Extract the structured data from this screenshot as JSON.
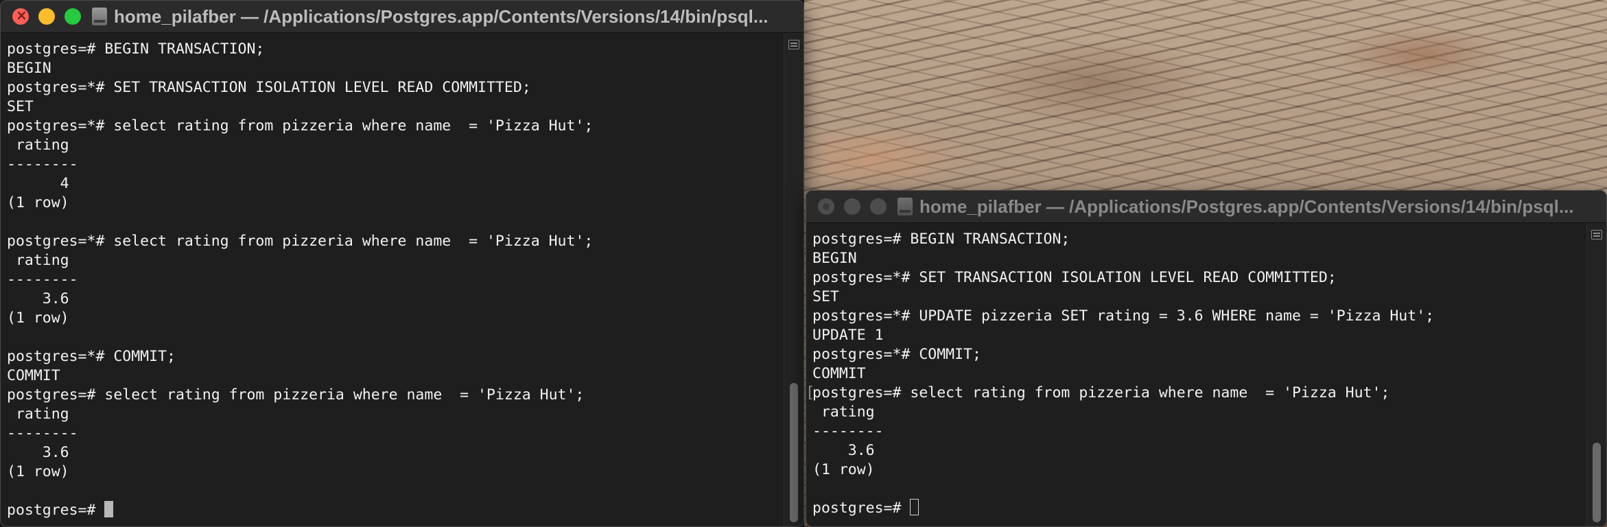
{
  "windows": [
    {
      "title": "home_pilafber — /Applications/Postgres.app/Contents/Versions/14/bin/psql...",
      "lines": [
        "postgres=# BEGIN TRANSACTION;",
        "BEGIN",
        "postgres=*# SET TRANSACTION ISOLATION LEVEL READ COMMITTED;",
        "SET",
        "postgres=*# select rating from pizzeria where name  = 'Pizza Hut';",
        " rating",
        "--------",
        "      4",
        "(1 row)",
        "",
        "postgres=*# select rating from pizzeria where name  = 'Pizza Hut';",
        " rating",
        "--------",
        "    3.6",
        "(1 row)",
        "",
        "postgres=*# COMMIT;",
        "COMMIT",
        "postgres=# select rating from pizzeria where name  = 'Pizza Hut';",
        " rating",
        "--------",
        "    3.6",
        "(1 row)",
        ""
      ],
      "prompt": "postgres=# "
    },
    {
      "title": "home_pilafber — /Applications/Postgres.app/Contents/Versions/14/bin/psql...",
      "lines": [
        "postgres=# BEGIN TRANSACTION;",
        "BEGIN",
        "postgres=*# SET TRANSACTION ISOLATION LEVEL READ COMMITTED;",
        "SET",
        "postgres=*# UPDATE pizzeria SET rating = 3.6 WHERE name = 'Pizza Hut';",
        "UPDATE 1",
        "postgres=*# COMMIT;",
        "COMMIT",
        "postgres=# select rating from pizzeria where name  = 'Pizza Hut';",
        " rating",
        "--------",
        "    3.6",
        "(1 row)",
        ""
      ],
      "prompt": "postgres=# "
    }
  ],
  "colors": {
    "close": "#ff5f57",
    "minimize": "#febc2e",
    "zoom": "#28c840",
    "terminal_bg": "#1e1e1e",
    "terminal_text": "#f2f2f2"
  },
  "icons": {
    "window_icon": "disk-icon",
    "scroll_menu": "scroll-marks-icon"
  }
}
